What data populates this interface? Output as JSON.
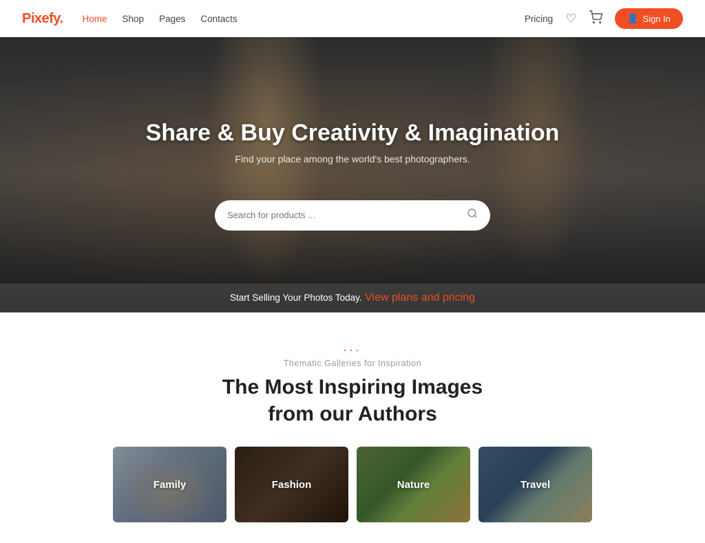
{
  "brand": {
    "name": "Pixefy",
    "dot": "."
  },
  "navbar": {
    "links": [
      {
        "label": "Home",
        "active": true
      },
      {
        "label": "Shop",
        "active": false
      },
      {
        "label": "Pages",
        "active": false
      },
      {
        "label": "Contacts",
        "active": false
      }
    ],
    "pricing_label": "Pricing",
    "sign_in_label": "Sign In"
  },
  "hero": {
    "title": "Share & Buy Creativity & Imagination",
    "subtitle": "Find your place among the world's best photographers.",
    "search_placeholder": "Search for products ...",
    "cta_text": "Start Selling Your Photos Today.",
    "cta_link_text": "View plans and pricing"
  },
  "gallery_section": {
    "dots": "...",
    "subtitle": "Thematic Galleries for Inspiration",
    "title_line1": "The Most Inspiring Images",
    "title_line2": "from our Authors",
    "cards": [
      {
        "label": "Family",
        "theme": "family"
      },
      {
        "label": "Fashion",
        "theme": "fashion"
      },
      {
        "label": "Nature",
        "theme": "nature"
      },
      {
        "label": "Travel",
        "theme": "travel"
      }
    ]
  }
}
